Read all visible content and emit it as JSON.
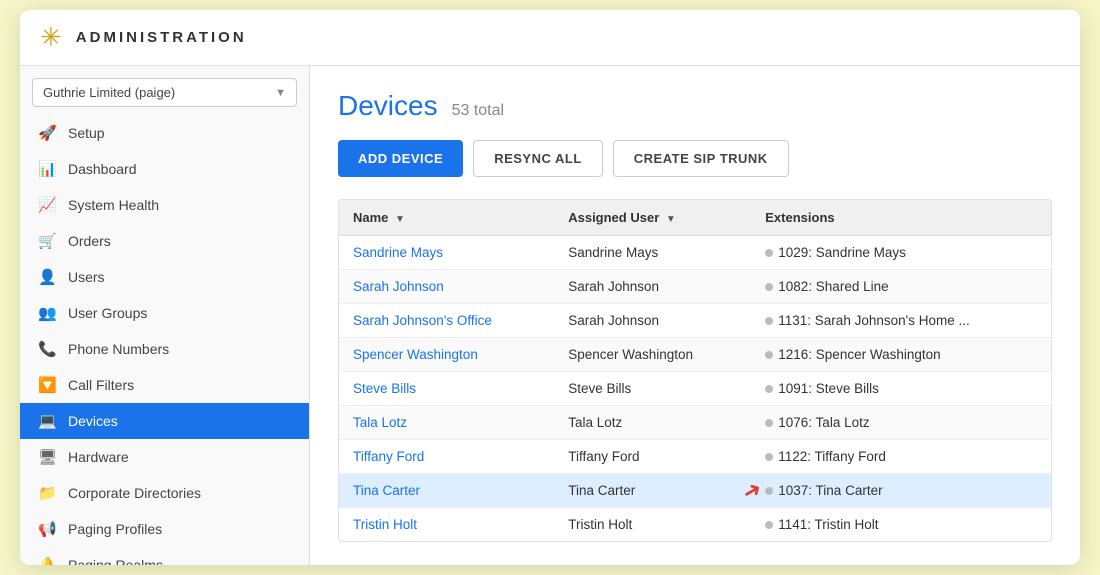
{
  "header": {
    "logo_symbol": "✳",
    "title": "ADMINISTRATION"
  },
  "sidebar": {
    "dropdown_label": "Guthrie Limited (paige)",
    "items": [
      {
        "id": "setup",
        "label": "Setup",
        "icon": "🚀",
        "active": false
      },
      {
        "id": "dashboard",
        "label": "Dashboard",
        "icon": "📊",
        "active": false
      },
      {
        "id": "system-health",
        "label": "System Health",
        "icon": "📈",
        "active": false
      },
      {
        "id": "orders",
        "label": "Orders",
        "icon": "🛒",
        "active": false
      },
      {
        "id": "users",
        "label": "Users",
        "icon": "👤",
        "active": false
      },
      {
        "id": "user-groups",
        "label": "User Groups",
        "icon": "👥",
        "active": false
      },
      {
        "id": "phone-numbers",
        "label": "Phone Numbers",
        "icon": "📞",
        "active": false
      },
      {
        "id": "call-filters",
        "label": "Call Filters",
        "icon": "🔽",
        "active": false
      },
      {
        "id": "devices",
        "label": "Devices",
        "icon": "💻",
        "active": true
      },
      {
        "id": "hardware",
        "label": "Hardware",
        "icon": "🖥",
        "active": false
      },
      {
        "id": "corporate-directories",
        "label": "Corporate Directories",
        "icon": "📁",
        "active": false
      },
      {
        "id": "paging-profiles",
        "label": "Paging Profiles",
        "icon": "📢",
        "active": false
      },
      {
        "id": "paging-realms",
        "label": "Paging Realms",
        "icon": "🔔",
        "active": false
      }
    ]
  },
  "main": {
    "page_title": "Devices",
    "page_count": "53 total",
    "buttons": {
      "add": "ADD DEVICE",
      "resync": "RESYNC ALL",
      "sip": "CREATE SIP TRUNK"
    },
    "table": {
      "columns": [
        {
          "id": "name",
          "label": "Name",
          "sortable": true
        },
        {
          "id": "assigned_user",
          "label": "Assigned User",
          "sortable": true
        },
        {
          "id": "extensions",
          "label": "Extensions",
          "sortable": false
        }
      ],
      "rows": [
        {
          "name": "Sandrine Mays",
          "assigned_user": "Sandrine Mays",
          "extension": "1029: Sandrine Mays",
          "highlighted": false
        },
        {
          "name": "Sarah Johnson",
          "assigned_user": "Sarah Johnson",
          "extension": "1082: Shared Line",
          "highlighted": false
        },
        {
          "name": "Sarah Johnson's Office",
          "assigned_user": "Sarah Johnson",
          "extension": "1131: Sarah Johnson's Home ...",
          "highlighted": false
        },
        {
          "name": "Spencer Washington",
          "assigned_user": "Spencer Washington",
          "extension": "1216: Spencer Washington",
          "highlighted": false
        },
        {
          "name": "Steve Bills",
          "assigned_user": "Steve Bills",
          "extension": "1091: Steve Bills",
          "highlighted": false
        },
        {
          "name": "Tala Lotz",
          "assigned_user": "Tala Lotz",
          "extension": "1076: Tala Lotz",
          "highlighted": false
        },
        {
          "name": "Tiffany Ford",
          "assigned_user": "Tiffany Ford",
          "extension": "1122: Tiffany Ford",
          "highlighted": false
        },
        {
          "name": "Tina Carter",
          "assigned_user": "Tina Carter",
          "extension": "1037: Tina Carter",
          "highlighted": true
        },
        {
          "name": "Tristin Holt",
          "assigned_user": "Tristin Holt",
          "extension": "1141: Tristin Holt",
          "highlighted": false
        }
      ]
    }
  }
}
